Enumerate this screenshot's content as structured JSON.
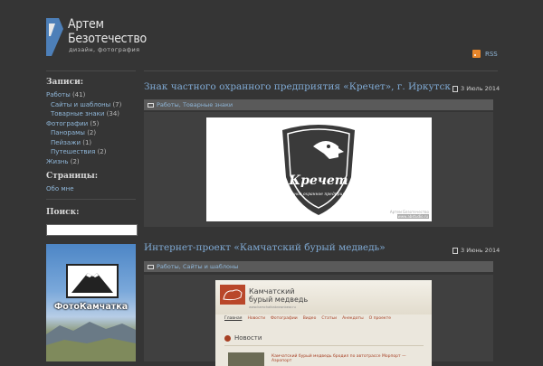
{
  "header": {
    "logo_line1": "Артем",
    "logo_line2": "Безотечество",
    "logo_tagline": "дизайн, фотография",
    "rss_label": "RSS"
  },
  "sidebar": {
    "records_heading": "Записи:",
    "categories": [
      {
        "label": "Работы",
        "count": "(41)",
        "level": 0
      },
      {
        "label": "Сайты и шаблоны",
        "count": "(7)",
        "level": 1
      },
      {
        "label": "Товарные знаки",
        "count": "(34)",
        "level": 1
      },
      {
        "label": "Фотографии",
        "count": "(5)",
        "level": 0
      },
      {
        "label": "Панорамы",
        "count": "(2)",
        "level": 1
      },
      {
        "label": "Пейзажи",
        "count": "(1)",
        "level": 1
      },
      {
        "label": "Путешествия",
        "count": "(2)",
        "level": 1
      },
      {
        "label": "Жизнь",
        "count": "(2)",
        "level": 0
      }
    ],
    "pages_heading": "Страницы:",
    "pages": [
      {
        "label": "Обо мне"
      }
    ],
    "search_heading": "Поиск:",
    "banner_text": "ФотоКамчатка"
  },
  "posts": [
    {
      "title": "Знак частного охранного предприятия «Кречет», г. Иркутск",
      "date": "3 Июль 2014",
      "tags": "Работы, Товарные знаки",
      "logo_name": "Кречет",
      "logo_sub": "частное охранное предприятие",
      "image_caption1": "Артем Безотечество",
      "image_caption2": "www.abstudio.ru"
    },
    {
      "title": "Интернет-проект «Камчатский бурый медведь»",
      "date": "3 Июнь 2014",
      "tags": "Работы, Сайты и шаблоны",
      "site_title1": "Камчатский",
      "site_title2": "бурый медведь",
      "site_url": "www.kamchatkabrownbear.ru",
      "site_nav": [
        "Главная",
        "Новости",
        "Фотографии",
        "Видео",
        "Статьи",
        "Анекдоты",
        "О проекте"
      ],
      "site_news_label": "Новости",
      "site_snippet": "Камчатский бурый медведь бродил по автотрассе Морпорт — Аэропорт"
    }
  ],
  "colors": {
    "background": "#353535",
    "link": "#8fb6d8",
    "title": "#7fa9d3",
    "rss": "#e8862b"
  }
}
